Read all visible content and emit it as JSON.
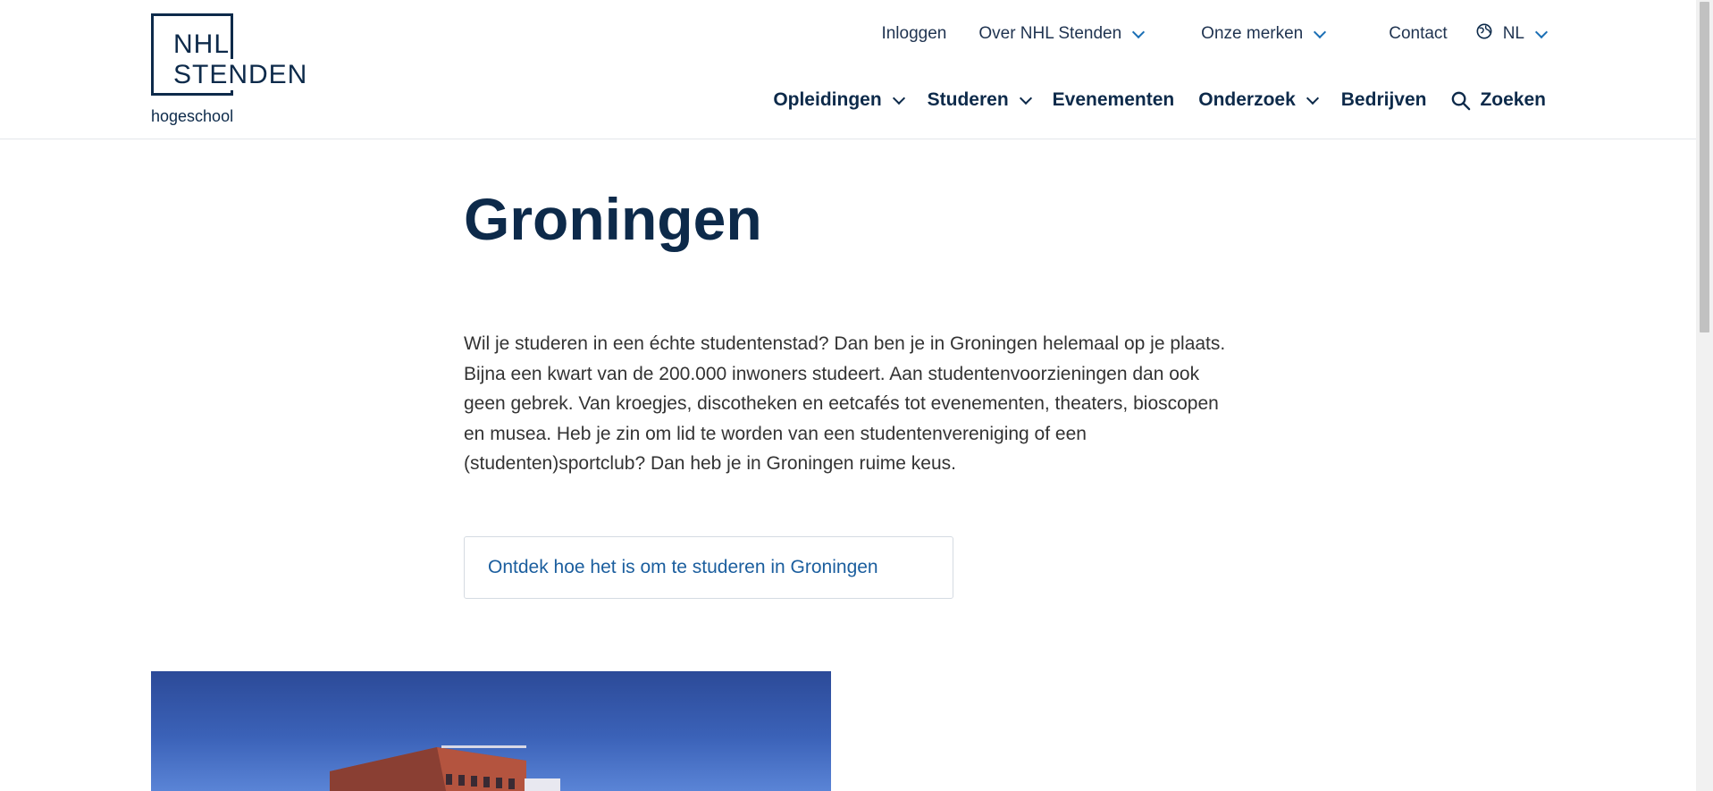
{
  "logo": {
    "line1": "NHL",
    "line2": "STENDEN",
    "sub": "hogeschool"
  },
  "top_nav": [
    {
      "label": "Inloggen",
      "dropdown": false
    },
    {
      "label": "Over NHL Stenden",
      "dropdown": true
    },
    {
      "label": "Onze merken",
      "dropdown": true
    },
    {
      "label": "Contact",
      "dropdown": false
    }
  ],
  "language": {
    "icon": "globe-icon",
    "label": "NL"
  },
  "main_nav": [
    {
      "label": "Opleidingen",
      "dropdown": true
    },
    {
      "label": "Studeren",
      "dropdown": true
    },
    {
      "label": "Evenementen",
      "dropdown": false
    },
    {
      "label": "Onderzoek",
      "dropdown": true
    },
    {
      "label": "Bedrijven",
      "dropdown": false
    }
  ],
  "search": {
    "icon": "search-icon",
    "label": "Zoeken"
  },
  "page": {
    "title": "Groningen",
    "intro": "Wil je studeren in een échte studentenstad? Dan ben je in Groningen helemaal op je plaats. Bijna een kwart van de 200.000 inwoners studeert. Aan studentenvoorzieningen dan ook geen gebrek. Van kroegjes, discotheken en eetcafés tot evenementen, theaters, bioscopen en musea. Heb je zin om lid te worden van een studentenvereniging of een (studenten)sportclub? Dan heb je in Groningen ruime keus.",
    "cta": "Ontdek hoe het is om te studeren in Groningen"
  },
  "colors": {
    "brand_navy": "#0d2a4a",
    "link_blue": "#1b5e9e",
    "chevron_blue": "#1b6fb5"
  }
}
